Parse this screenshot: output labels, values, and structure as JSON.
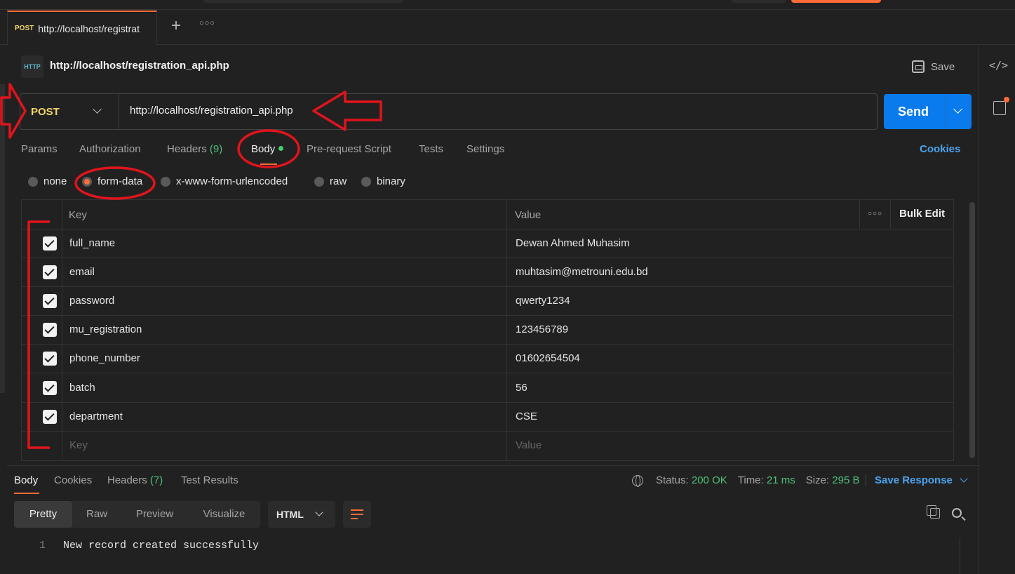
{
  "tab": {
    "method": "POST",
    "title": "http://localhost/registrat"
  },
  "request": {
    "icon_label": "HTTP",
    "title": "http://localhost/registration_api.php",
    "save_label": "Save",
    "method": "POST",
    "url": "http://localhost/registration_api.php",
    "send_label": "Send"
  },
  "request_tabs": {
    "params": "Params",
    "authorization": "Authorization",
    "headers": "Headers",
    "headers_count": "(9)",
    "body": "Body",
    "prerequest": "Pre-request Script",
    "tests": "Tests",
    "settings": "Settings",
    "cookies": "Cookies"
  },
  "body_types": {
    "none": "none",
    "form_data": "form-data",
    "urlencoded": "x-www-form-urlencoded",
    "raw": "raw",
    "binary": "binary",
    "selected": "form-data"
  },
  "form_table": {
    "key_header": "Key",
    "value_header": "Value",
    "bulk_edit": "Bulk Edit",
    "rows": [
      {
        "key": "full_name",
        "value": "Dewan Ahmed Muhasim",
        "checked": true
      },
      {
        "key": "email",
        "value": "muhtasim@metrouni.edu.bd",
        "checked": true
      },
      {
        "key": "password",
        "value": "qwerty1234",
        "checked": true
      },
      {
        "key": "mu_registration",
        "value": "123456789",
        "checked": true
      },
      {
        "key": "phone_number",
        "value": "01602654504",
        "checked": true
      },
      {
        "key": "batch",
        "value": "56",
        "checked": true
      },
      {
        "key": "department",
        "value": "CSE",
        "checked": true
      }
    ],
    "key_placeholder": "Key",
    "value_placeholder": "Value"
  },
  "response": {
    "tabs": {
      "body": "Body",
      "cookies": "Cookies",
      "headers": "Headers",
      "headers_count": "(7)",
      "test_results": "Test Results"
    },
    "status_label": "Status:",
    "status_value": "200 OK",
    "time_label": "Time:",
    "time_value": "21 ms",
    "size_label": "Size:",
    "size_value": "295 B",
    "save_response": "Save Response",
    "views": {
      "pretty": "Pretty",
      "raw": "Raw",
      "preview": "Preview",
      "visualize": "Visualize"
    },
    "format": "HTML",
    "line_number": "1",
    "line_text": "New record created successfully"
  },
  "colors": {
    "accent": "#ff6c37",
    "send": "#097bed",
    "method": "#f5d66b",
    "success": "#4ec07a",
    "link": "#4ca3ee",
    "annotation": "#e0141c"
  }
}
